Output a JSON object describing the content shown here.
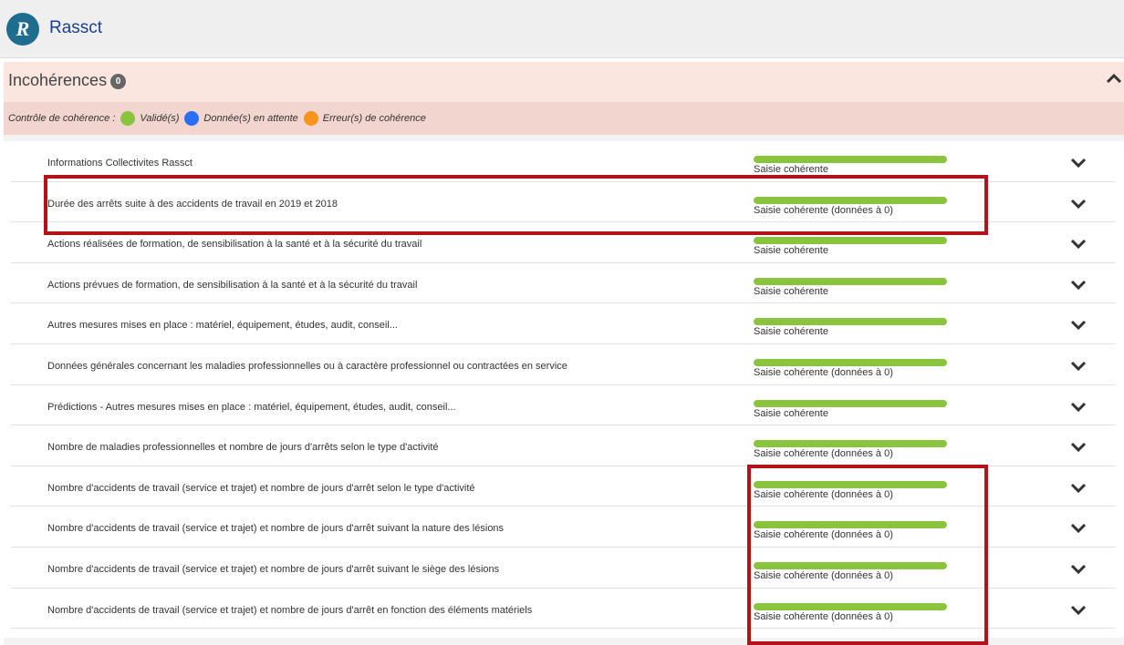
{
  "header": {
    "app_title": "Rassct",
    "logo_letter": "R"
  },
  "section": {
    "title": "Incohérences",
    "count": "0"
  },
  "legend": {
    "label": "Contrôle de cohérence :",
    "items": [
      {
        "label": "Validé(s)",
        "color": "#8ac33e"
      },
      {
        "label": "Donnée(s) en attente",
        "color": "#2a6ef5"
      },
      {
        "label": "Erreur(s) de cohérence",
        "color": "#f7941d"
      }
    ]
  },
  "rows": [
    {
      "title": "Informations Collectivites Rassct",
      "status": "Saisie cohérente",
      "progress": 1.0
    },
    {
      "title": "Durée des arrêts suite à des accidents de travail en 2019 et 2018",
      "status": "Saisie cohérente (données à 0)",
      "progress": 1.0
    },
    {
      "title": "Actions réalisées de formation, de sensibilisation à la santé et à la sécurité du travail",
      "status": "Saisie cohérente",
      "progress": 1.0
    },
    {
      "title": "Actions prévues de formation, de sensibilisation à la santé et à la sécurité du travail",
      "status": "Saisie cohérente",
      "progress": 1.0
    },
    {
      "title": "Autres mesures mises en place : matériel, équipement, études, audit, conseil...",
      "status": "Saisie cohérente",
      "progress": 1.0
    },
    {
      "title": "Données générales concernant les maladies professionnelles ou à caractère professionnel ou contractées en service",
      "status": "Saisie cohérente (données à 0)",
      "progress": 1.0
    },
    {
      "title": "Prédictions - Autres mesures mises en place : matériel, équipement, études, audit, conseil...",
      "status": "Saisie cohérente",
      "progress": 1.0
    },
    {
      "title": "Nombre de maladies professionnelles et nombre de jours d'arrêts selon le type d'activité",
      "status": "Saisie cohérente (données à 0)",
      "progress": 1.0
    },
    {
      "title": "Nombre d'accidents de travail (service et trajet) et nombre de jours d'arrêt selon le type d'activité",
      "status": "Saisie cohérente (données à 0)",
      "progress": 1.0
    },
    {
      "title": "Nombre d'accidents de travail (service et trajet) et nombre de jours d'arrêt suivant la nature des lésions",
      "status": "Saisie cohérente (données à 0)",
      "progress": 1.0
    },
    {
      "title": "Nombre d'accidents de travail (service et trajet) et nombre de jours d'arrêt suivant le siège des lésions",
      "status": "Saisie cohérente (données à 0)",
      "progress": 1.0
    },
    {
      "title": "Nombre d'accidents de travail (service et trajet) et nombre de jours d'arrêt en fonction des éléments matériels",
      "status": "Saisie cohérente (données à 0)",
      "progress": 1.0
    }
  ],
  "colors": {
    "success": "#8ac33e",
    "highlight": "#b3121a",
    "title": "#1c3f8c"
  }
}
